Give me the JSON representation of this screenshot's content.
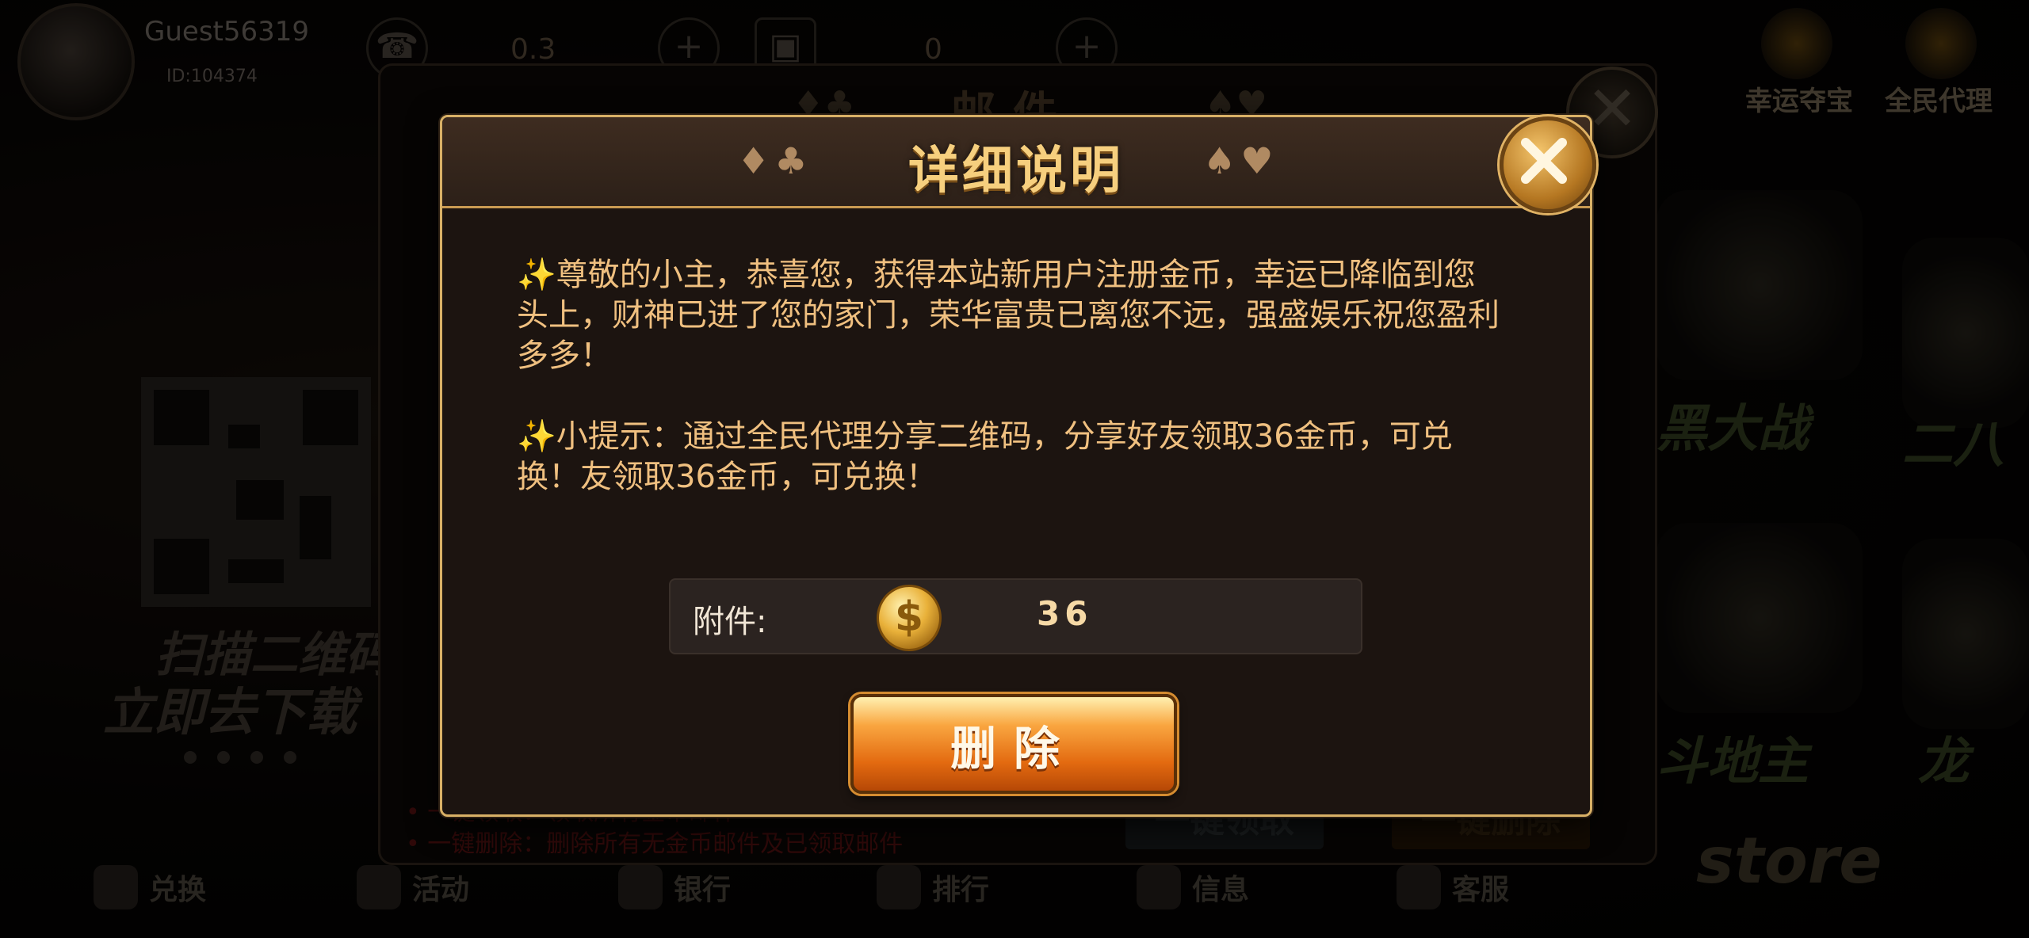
{
  "lobby": {
    "user": {
      "name": "Guest56319",
      "id": "ID:104374"
    },
    "top_numbers": [
      "0.3",
      "0"
    ],
    "top_right": [
      "幸运夺宝",
      "全民代理"
    ],
    "scan_text": [
      "扫描二维码",
      "立即去下载"
    ],
    "games": [
      "黑大战",
      "二八",
      "斗地主",
      "龙"
    ],
    "nav": [
      "兑换",
      "活动",
      "银行",
      "排行",
      "信息",
      "客服"
    ],
    "store": "store"
  },
  "mail": {
    "title": "邮件",
    "notes": [
      "• 一键领取：领取所有金币邮件",
      "• 一键删除：删除所有无金币邮件及已领取邮件"
    ],
    "buttons": [
      "一键领取",
      "一键删除"
    ]
  },
  "dialog": {
    "title": "详细说明",
    "suits_left": "♦♣",
    "suits_right": "♠♥",
    "messages": [
      "✨尊敬的小主，恭喜您，获得本站新用户注册金币，幸运已降临到您头上，财神已进了您的家门，荣华富贵已离您不远，强盛娱乐祝您盈利多多！",
      "✨小提示：通过全民代理分享二维码，分享好友领取36金币，可兑换！友领取36金币，可兑换！"
    ],
    "attachment": {
      "label": "附件:",
      "icon": "gold-coin-icon",
      "value": "36"
    },
    "delete_label": "删除"
  }
}
